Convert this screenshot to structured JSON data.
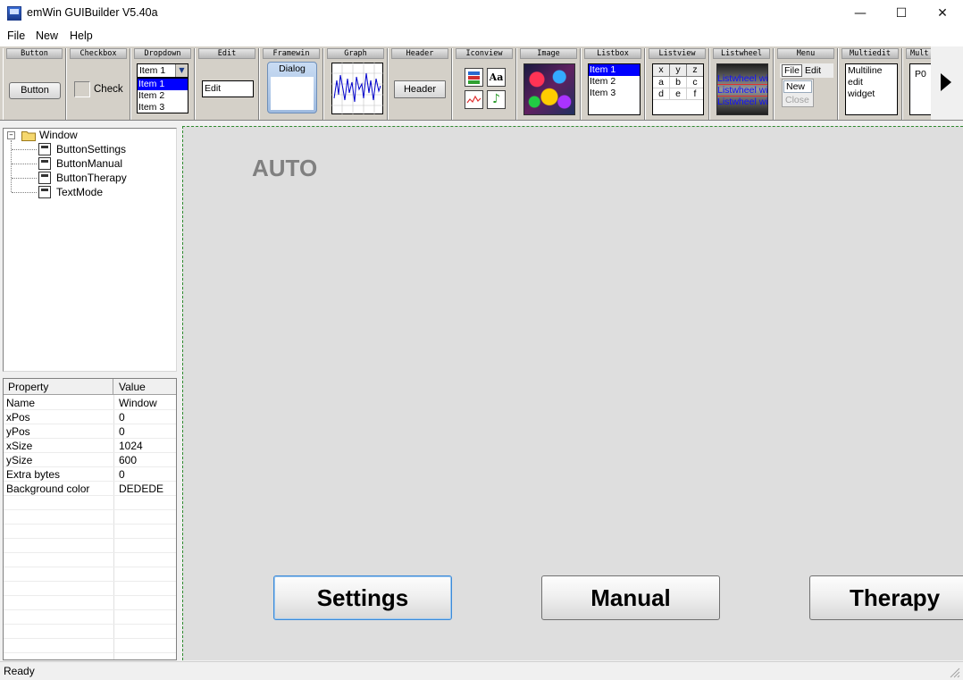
{
  "window": {
    "title": "emWin GUIBuilder V5.40a"
  },
  "menu": [
    "File",
    "New",
    "Help"
  ],
  "toolbar": {
    "widgets": [
      "Button",
      "Checkbox",
      "Dropdown",
      "Edit",
      "Framewin",
      "Graph",
      "Header",
      "Iconview",
      "Image",
      "Listbox",
      "Listview",
      "Listwheel",
      "Menu",
      "Multiedit",
      "Mult"
    ],
    "button_sample": "Button",
    "checkbox_sample": "Check",
    "dropdown_selected": "Item 1",
    "dropdown_items": [
      "Item 1",
      "Item 2",
      "Item 3"
    ],
    "edit_sample": "Edit",
    "framewin_sample": "Dialog",
    "header_sample": "Header",
    "iconview_text_icon": "Aa",
    "listbox_items": [
      "Item 1",
      "Item 2",
      "Item 3"
    ],
    "listview_cols": [
      "x",
      "y",
      "z"
    ],
    "listview_rows": [
      [
        "a",
        "b",
        "c"
      ],
      [
        "d",
        "e",
        "f"
      ]
    ],
    "listwheel_items": [
      "Listwheel wid",
      "Listwheel wid",
      "Listwheel wid"
    ],
    "menu_bar_items": [
      "File",
      "Edit"
    ],
    "menu_drop_items": [
      "New",
      "Close"
    ],
    "multiedit_lines": [
      "Multiline",
      "edit",
      "widget"
    ],
    "mult_sample": "P0"
  },
  "tree": {
    "root": "Window",
    "children": [
      "ButtonSettings",
      "ButtonManual",
      "ButtonTherapy",
      "TextMode"
    ]
  },
  "properties": {
    "headers": [
      "Property",
      "Value"
    ],
    "rows": [
      [
        "Name",
        "Window"
      ],
      [
        "xPos",
        "0"
      ],
      [
        "yPos",
        "0"
      ],
      [
        "xSize",
        "1024"
      ],
      [
        "ySize",
        "600"
      ],
      [
        "Extra bytes",
        "0"
      ],
      [
        "Background color",
        "DEDEDE"
      ]
    ]
  },
  "canvas": {
    "mode_text": "AUTO",
    "buttons": [
      "Settings",
      "Manual",
      "Therapy"
    ],
    "background": "#DEDEDE"
  },
  "status": "Ready"
}
